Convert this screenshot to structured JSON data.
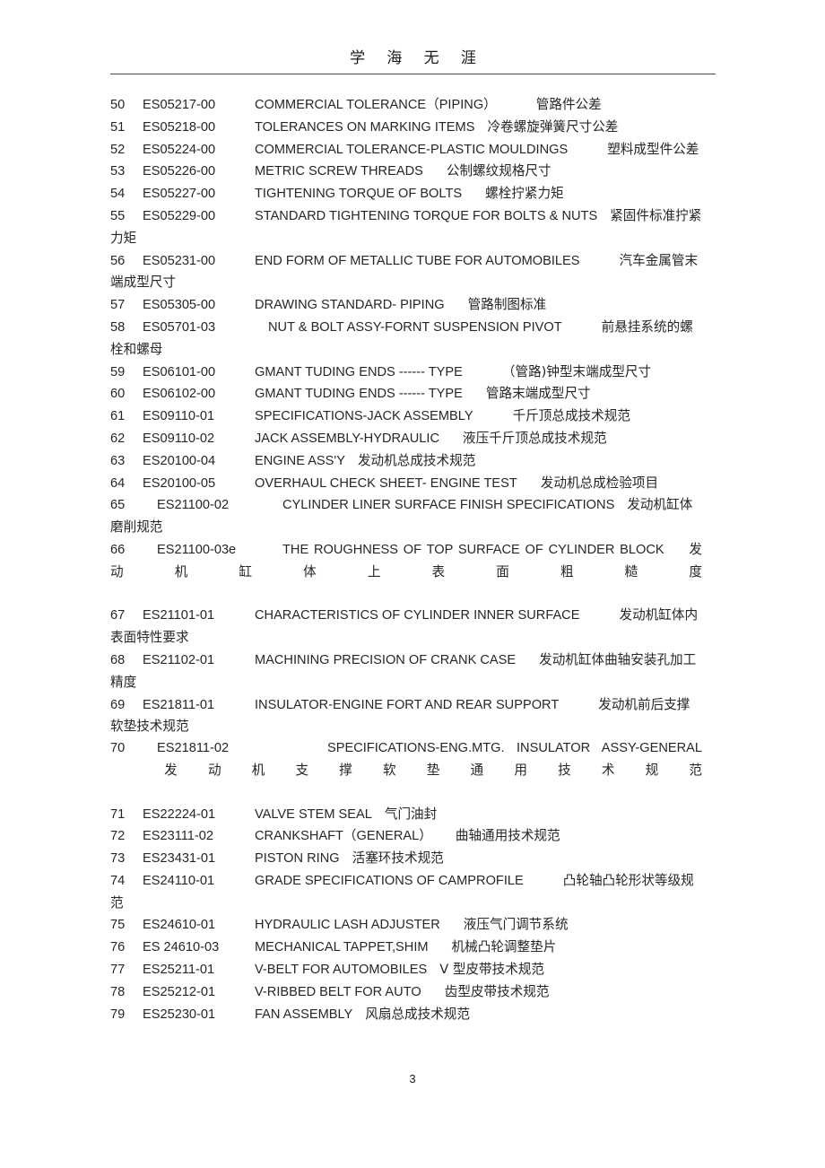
{
  "header": {
    "title": "学 海 无 涯"
  },
  "footer": {
    "page_number": "3"
  },
  "entries": [
    {
      "num": "50",
      "code": "ES05217-00",
      "en": "COMMERCIAL TOLERANCE（PIPING）",
      "cn": "管路件公差"
    },
    {
      "num": "51",
      "code": "ES05218-00",
      "en": "TOLERANCES ON MARKING ITEMS",
      "cn": "冷卷螺旋弹簧尺寸公差"
    },
    {
      "num": "52",
      "code": "ES05224-00",
      "en": "COMMERCIAL TOLERANCE-PLASTIC MOULDINGS",
      "cn": "塑料成型件公差"
    },
    {
      "num": "53",
      "code": "ES05226-00",
      "en": "METRIC SCREW THREADS",
      "cn": "公制螺纹规格尺寸"
    },
    {
      "num": "54",
      "code": "ES05227-00",
      "en": "TIGHTENING TORQUE OF BOLTS",
      "cn": "螺栓拧紧力矩"
    },
    {
      "num": "55",
      "code": "ES05229-00",
      "en": "STANDARD TIGHTENING TORQUE FOR BOLTS & NUTS",
      "cn": "紧固件标准拧紧力矩"
    },
    {
      "num": "56",
      "code": "ES05231-00",
      "en": "END FORM OF METALLIC TUBE FOR AUTOMOBILES",
      "cn": "汽车金属管末端成型尺寸"
    },
    {
      "num": "57",
      "code": "ES05305-00",
      "en": "DRAWING STANDARD- PIPING",
      "cn": "管路制图标准"
    },
    {
      "num": "58",
      "code": "ES05701-03",
      "en": "NUT & BOLT ASSY-FORNT SUSPENSION PIVOT",
      "cn": "前悬挂系统的螺栓和螺母"
    },
    {
      "num": "59",
      "code": "ES06101-00",
      "en": "GMANT TUDING ENDS ------ TYPE",
      "cn": "（管路)钟型末端成型尺寸"
    },
    {
      "num": "60",
      "code": "ES06102-00",
      "en": "GMANT TUDING ENDS ------ TYPE",
      "cn": "管路末端成型尺寸"
    },
    {
      "num": "61",
      "code": "ES09110-01",
      "en": "SPECIFICATIONS-JACK ASSEMBLY",
      "cn": "千斤顶总成技术规范"
    },
    {
      "num": "62",
      "code": "ES09110-02",
      "en": "JACK ASSEMBLY-HYDRAULIC",
      "cn": "液压千斤顶总成技术规范"
    },
    {
      "num": "63",
      "code": "ES20100-04",
      "en": "ENGINE ASS'Y",
      "cn": "发动机总成技术规范"
    },
    {
      "num": "64",
      "code": "ES20100-05",
      "en": "OVERHAUL CHECK SHEET- ENGINE TEST",
      "cn": "发动机总成检验项目"
    },
    {
      "num": "65",
      "code": "ES21100-02",
      "en": "CYLINDER LINER SURFACE FINISH SPECIFICATIONS",
      "cn": "发动机缸体磨削规范"
    },
    {
      "num": "66",
      "code": "ES21100-03e",
      "en": "THE ROUGHNESS OF TOP SURFACE OF CYLINDER BLOCK",
      "cn": "发动机缸体上表面粗糙度"
    },
    {
      "num": "67",
      "code": "ES21101-01",
      "en": "CHARACTERISTICS OF CYLINDER INNER SURFACE",
      "cn": "发动机缸体内表面特性要求"
    },
    {
      "num": "68",
      "code": "ES21102-01",
      "en": "MACHINING PRECISION OF CRANK CASE",
      "cn": "发动机缸体曲轴安装孔加工精度"
    },
    {
      "num": "69",
      "code": "ES21811-01",
      "en": "INSULATOR-ENGINE FORT AND REAR SUPPORT",
      "cn": "发动机前后支撑软垫技术规范"
    },
    {
      "num": "70",
      "code": "ES21811-02",
      "en": "SPECIFICATIONS-ENG.MTG. INSULATOR ASSY-GENERAL",
      "cn": "发动机支撑软垫通用技术规范"
    },
    {
      "num": "71",
      "code": "ES22224-01",
      "en": "VALVE STEM SEAL",
      "cn": "气门油封"
    },
    {
      "num": "72",
      "code": "ES23111-02",
      "en": "CRANKSHAFT（GENERAL）",
      "cn": "曲轴通用技术规范"
    },
    {
      "num": "73",
      "code": "ES23431-01",
      "en": "PISTON RING",
      "cn": "活塞环技术规范"
    },
    {
      "num": "74",
      "code": "ES24110-01",
      "en": "GRADE SPECIFICATIONS OF CAMPROFILE",
      "cn": "凸轮轴凸轮形状等级规范"
    },
    {
      "num": "75",
      "code": "ES24610-01",
      "en": "HYDRAULIC LASH ADJUSTER",
      "cn": "液压气门调节系统"
    },
    {
      "num": "76",
      "code": "ES 24610-03",
      "en": "MECHANICAL TAPPET,SHIM",
      "cn": "机械凸轮调整垫片"
    },
    {
      "num": "77",
      "code": "ES25211-01",
      "en": "V-BELT FOR AUTOMOBILES",
      "cn": "V 型皮带技术规范"
    },
    {
      "num": "78",
      "code": "ES25212-01",
      "en": "V-RIBBED BELT FOR  AUTO",
      "cn": "齿型皮带技术规范"
    },
    {
      "num": "79",
      "code": "ES25230-01",
      "en": "FAN ASSEMBLY",
      "cn": "风扇总成技术规范"
    }
  ]
}
